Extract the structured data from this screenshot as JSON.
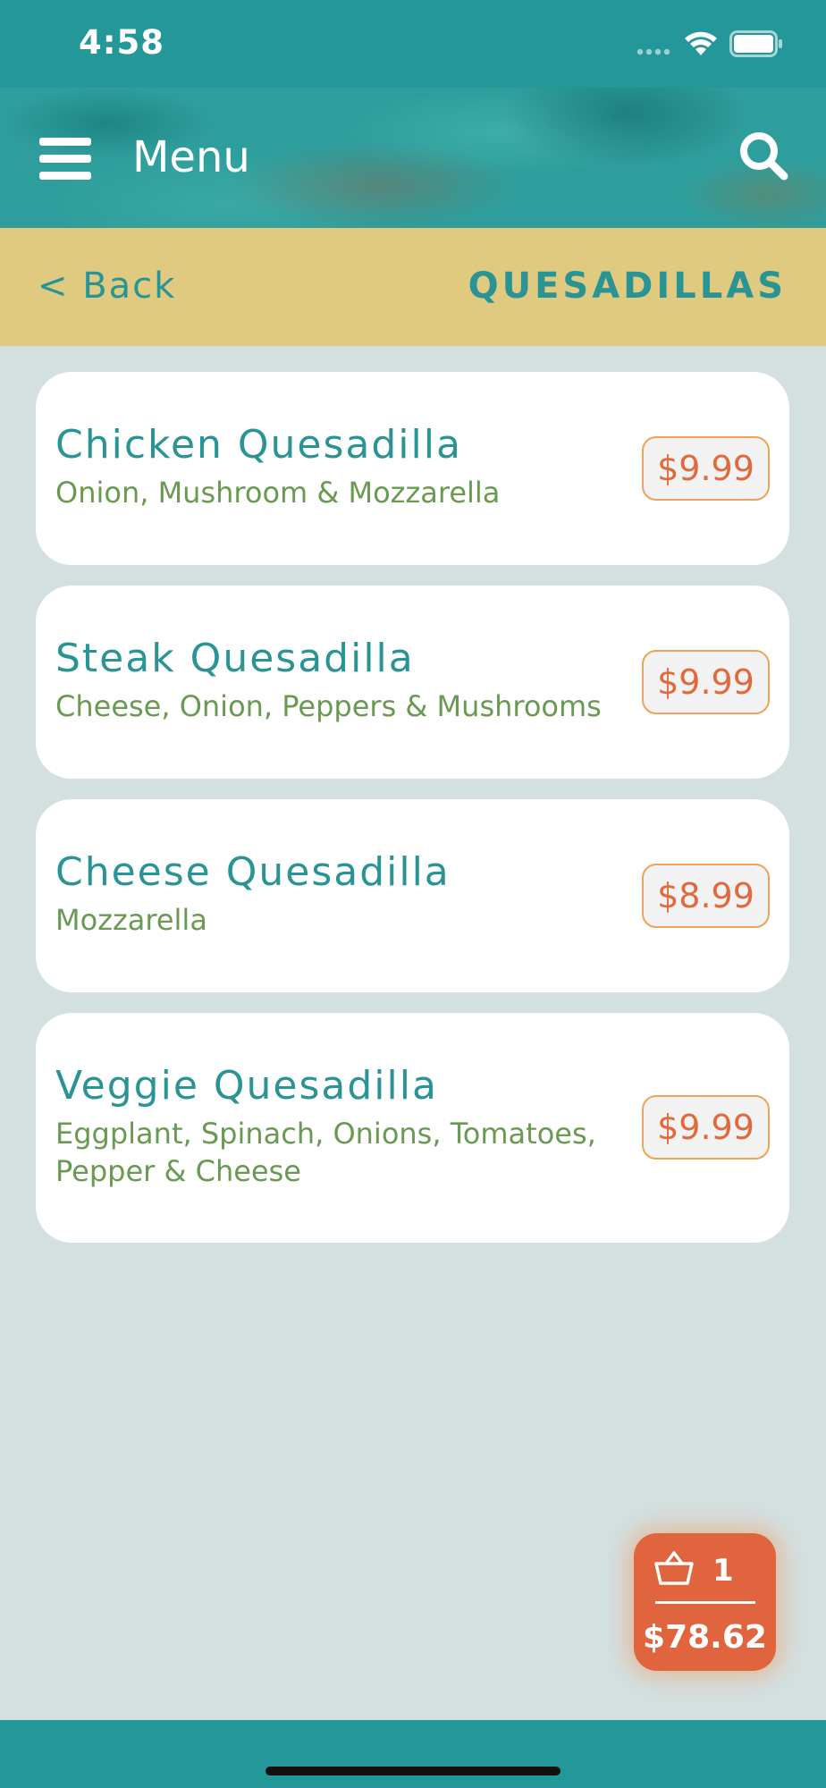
{
  "status_bar": {
    "time": "4:58"
  },
  "header": {
    "title": "Menu"
  },
  "category": {
    "back_label": "< Back",
    "title": "QUESADILLAS"
  },
  "items": [
    {
      "name": "Chicken Quesadilla",
      "description": "Onion, Mushroom & Mozzarella",
      "price": "$9.99"
    },
    {
      "name": "Steak Quesadilla",
      "description": "Cheese, Onion, Peppers & Mushrooms",
      "price": "$9.99"
    },
    {
      "name": "Cheese Quesadilla",
      "description": "Mozzarella",
      "price": "$8.99"
    },
    {
      "name": "Veggie Quesadilla",
      "description": "Eggplant, Spinach, Onions, Tomatoes, Pepper & Cheese",
      "price": "$9.99"
    }
  ],
  "cart": {
    "count": "1",
    "total": "$78.62"
  },
  "colors": {
    "teal": "#249898",
    "gold": "#dfca80",
    "background": "#d4dfdf",
    "accent_orange": "#e0643e",
    "description_green": "#6a9a52"
  },
  "icons": [
    "hamburger-icon",
    "search-icon",
    "basket-icon",
    "wifi-icon",
    "battery-icon"
  ]
}
